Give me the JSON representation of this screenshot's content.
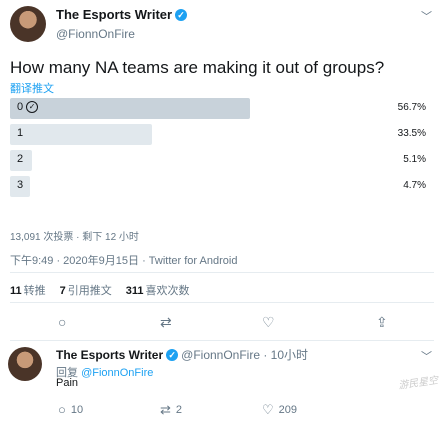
{
  "tweet": {
    "display_name": "The Esports Writer",
    "handle": "@FionnOnFire",
    "question": "How many NA teams are making it out of groups?",
    "translate_label": "翻译推文",
    "poll": {
      "options": [
        {
          "label": "0",
          "percent_text": "56.7%",
          "fraction": 0.567,
          "selected": true
        },
        {
          "label": "1",
          "percent_text": "33.5%",
          "fraction": 0.335,
          "selected": false
        },
        {
          "label": "2",
          "percent_text": "5.1%",
          "fraction": 0.051,
          "selected": false
        },
        {
          "label": "3",
          "percent_text": "4.7%",
          "fraction": 0.047,
          "selected": false
        }
      ],
      "meta": "13,091 次投票 · 剩下 12 小时"
    },
    "timestamp": "下午9:49 · 2020年9月15日 · Twitter for Android",
    "stats": {
      "retweets_count": "11",
      "retweets_label": "转推",
      "quotes_count": "7",
      "quotes_label": "引用推文",
      "likes_count": "311",
      "likes_label": "喜欢次数"
    }
  },
  "reply": {
    "display_name": "The Esports Writer",
    "handle_time": "@FionnOnFire · 10小时",
    "reply_prefix": "回复",
    "reply_target": "@FionnOnFire",
    "text": "Pain",
    "reply_count": "10",
    "retweet_count": "2",
    "like_count": "209"
  },
  "watermark": "游民星空"
}
